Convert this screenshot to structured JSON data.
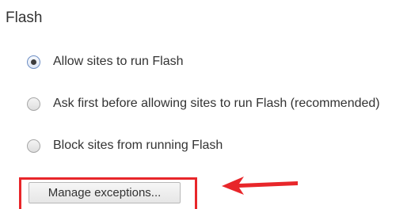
{
  "section": {
    "title": "Flash"
  },
  "options": [
    {
      "label": "Allow sites to run Flash",
      "checked": true
    },
    {
      "label": "Ask first before allowing sites to run Flash (recommended)",
      "checked": false
    },
    {
      "label": "Block sites from running Flash",
      "checked": false
    }
  ],
  "buttons": {
    "manage_exceptions": "Manage exceptions..."
  },
  "annotation": {
    "highlight_color": "#e8262a",
    "arrow_icon": "left-arrow-icon"
  }
}
